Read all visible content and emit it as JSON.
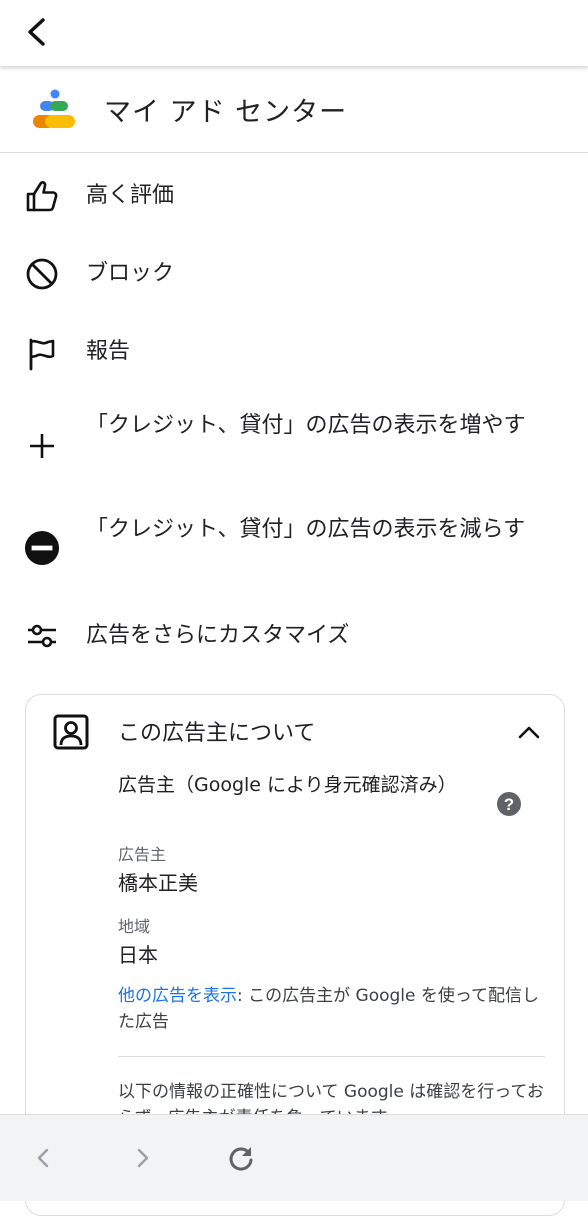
{
  "header": {
    "title": "マイ アド センター"
  },
  "menu": {
    "items": [
      {
        "label": "高く評価",
        "icon": "thumbs-up-icon"
      },
      {
        "label": "ブロック",
        "icon": "block-icon"
      },
      {
        "label": "報告",
        "icon": "flag-icon"
      },
      {
        "label": "「クレジット、貸付」の広告の表示を増やす",
        "icon": "plus-icon"
      },
      {
        "label": "「クレジット、貸付」の広告の表示を減らす",
        "icon": "minus-circle-icon"
      },
      {
        "label": "広告をさらにカスタマイズ",
        "icon": "tune-icon"
      }
    ]
  },
  "advertiser": {
    "section_title": "この広告主について",
    "verified_text": "広告主（Google により身元確認済み）",
    "advertiser_label": "広告主",
    "advertiser_name": "橋本正美",
    "region_label": "地域",
    "region_value": "日本",
    "more_ads_link": "他の広告を表示",
    "more_ads_text": ": この広告主が Google を使って配信した広告",
    "disclaimer": "以下の情報の正確性について Google は確認を行っておらず、広告主が責任を負っています。"
  },
  "colors": {
    "link": "#1a73e8",
    "logo_blue": "#4285f4",
    "logo_green": "#34a853",
    "logo_yellow": "#fbbc04",
    "logo_orange": "#ea8600"
  }
}
